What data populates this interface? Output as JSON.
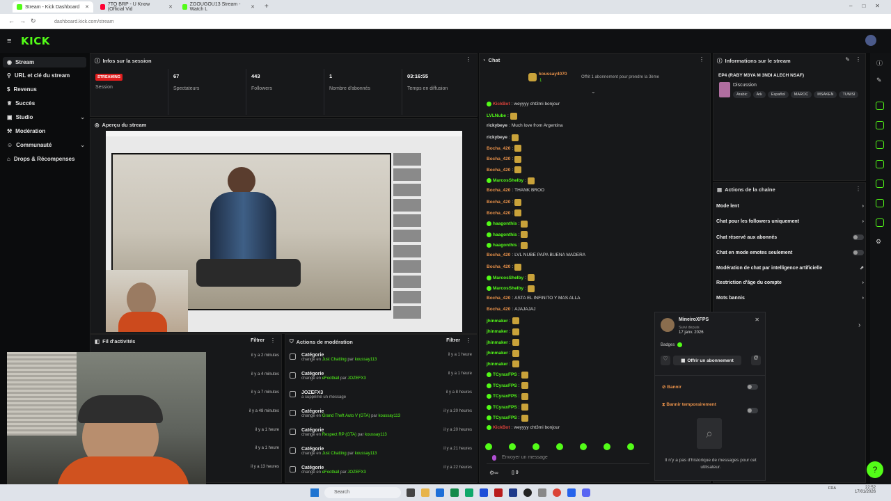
{
  "browser": {
    "tabs": [
      {
        "label": "Stream - Kick Dashboard",
        "color": "#53fc18"
      },
      {
        "label": "7TO BRP - U Know (Official Vid",
        "color": "#ff0033"
      },
      {
        "label": "ZGOUGOU13 Stream - Watch L",
        "color": "#53fc18"
      }
    ],
    "url": "dashboard.kick.com/stream"
  },
  "app": {
    "logo": "KICK"
  },
  "sidebar": {
    "items": [
      {
        "label": "Stream",
        "icon": "stream-icon"
      },
      {
        "label": "URL et clé du stream",
        "icon": "link-icon"
      },
      {
        "label": "Revenus",
        "icon": "dollar-icon"
      },
      {
        "label": "Succès",
        "icon": "trophy-icon"
      },
      {
        "label": "Studio",
        "icon": "studio-icon"
      },
      {
        "label": "Modération",
        "icon": "hammer-icon"
      },
      {
        "label": "Communauté",
        "icon": "users-icon"
      },
      {
        "label": "Drops & Récompenses",
        "icon": "gift-icon"
      }
    ]
  },
  "session": {
    "title": "Infos sur la session",
    "status": "STREAMING",
    "status_label": "Session",
    "stats": [
      {
        "value": "67",
        "label": "Spectateurs"
      },
      {
        "value": "443",
        "label": "Followers"
      },
      {
        "value": "1",
        "label": "Nombre d'abonnés"
      },
      {
        "value": "03:16:55",
        "label": "Temps en diffusion"
      }
    ]
  },
  "preview": {
    "title": "Aperçu du stream"
  },
  "activity": {
    "title": "Fil d'activités",
    "filter": "Filtrer",
    "rows": [
      "il y a 2 minutes",
      "il y a 4 minutes",
      "il y a 7 minutes",
      "il y a 48 minutes",
      "il y a 1 heure",
      "il y a 1 heure",
      "il y a 13 heures"
    ]
  },
  "moderation": {
    "title": "Actions de modération",
    "filter": "Filtrer",
    "rows": [
      {
        "title": "Catégorie",
        "pre": "changé en ",
        "target": "Just Chatting",
        "mid": " par ",
        "user": "koussay113",
        "time": "il y a 1 heure"
      },
      {
        "title": "Catégorie",
        "pre": "changé en ",
        "target": "eFootball",
        "mid": " par ",
        "user": "JOZEFX3",
        "time": "il y a 1 heure"
      },
      {
        "title": "JOZEFX3",
        "pre": "a supprimé un message",
        "target": "",
        "mid": "",
        "user": "",
        "time": "il y a 8 heures"
      },
      {
        "title": "Catégorie",
        "pre": "changé en ",
        "target": "Grand Theft Auto V (GTA)",
        "mid": " par ",
        "user": "koussay113",
        "time": "il y a 20 heures"
      },
      {
        "title": "Catégorie",
        "pre": "changé en ",
        "target": "Respect RP (GTA)",
        "mid": " par ",
        "user": "koussay113",
        "time": "il y a 20 heures"
      },
      {
        "title": "Catégorie",
        "pre": "changé en ",
        "target": "Just Chatting",
        "mid": " par ",
        "user": "koussay113",
        "time": "il y a 21 heures"
      },
      {
        "title": "Catégorie",
        "pre": "changé en ",
        "target": "eFootball",
        "mid": " par ",
        "user": "JOZEFX3",
        "time": "il y a 22 heures"
      }
    ]
  },
  "chat": {
    "title": "Chat",
    "pinned_user": "koussay4070",
    "pinned_count": "1",
    "pinned_text": "Offrit 1 abonnement pour prendre la 3ème",
    "placeholder": "Envoyer un message",
    "counter": "0",
    "messages": [
      {
        "user": "KickBot",
        "color": "#e0443c",
        "text": "weyyyy cht3mi bonjour",
        "verified": true
      },
      {
        "user": "LVLNube",
        "color": "#53fc18",
        "text": "",
        "verified": false,
        "emote": true
      },
      {
        "user": "rickybeye",
        "color": "#ddd",
        "text": "Much love from Argentina",
        "verified": false
      },
      {
        "user": "rickybeye",
        "color": "#ddd",
        "text": "",
        "verified": false,
        "emote": true
      },
      {
        "user": "Bocha_420",
        "color": "#e8914a",
        "text": "",
        "verified": false,
        "emote": true
      },
      {
        "user": "Bocha_420",
        "color": "#e8914a",
        "text": "",
        "verified": false,
        "emote": true
      },
      {
        "user": "Bocha_420",
        "color": "#e8914a",
        "text": "",
        "verified": false,
        "emote": true
      },
      {
        "user": "MarcosShelby",
        "color": "#53fc18",
        "text": "",
        "verified": true,
        "emote": true
      },
      {
        "user": "Bocha_420",
        "color": "#e8914a",
        "text": "THANK BROO",
        "verified": false
      },
      {
        "user": "Bocha_420",
        "color": "#e8914a",
        "text": "",
        "verified": false,
        "emote": true
      },
      {
        "user": "Bocha_420",
        "color": "#e8914a",
        "text": "",
        "verified": false,
        "emote": true
      },
      {
        "user": "haagonthis",
        "color": "#53fc18",
        "text": "",
        "verified": true,
        "emote": true
      },
      {
        "user": "haagonthis",
        "color": "#53fc18",
        "text": "",
        "verified": true,
        "emote": true
      },
      {
        "user": "haagonthis",
        "color": "#53fc18",
        "text": "",
        "verified": true,
        "emote": true
      },
      {
        "user": "Bocha_420",
        "color": "#e8914a",
        "text": "LVL NUBE PAPA BUENA MADERA",
        "verified": false
      },
      {
        "user": "Bocha_420",
        "color": "#e8914a",
        "text": "",
        "verified": false,
        "emote": true
      },
      {
        "user": "MarcosShelby",
        "color": "#53fc18",
        "text": "",
        "verified": true,
        "emote": true
      },
      {
        "user": "MarcosShelby",
        "color": "#53fc18",
        "text": "",
        "verified": true,
        "emote": true
      },
      {
        "user": "Bocha_420",
        "color": "#e8914a",
        "text": "ASTA EL INFINITO Y MAS ALLA",
        "verified": false
      },
      {
        "user": "Bocha_420",
        "color": "#e8914a",
        "text": "AJAJAJAJ",
        "verified": false
      },
      {
        "user": "jhinmaker",
        "color": "#53fc18",
        "text": "",
        "verified": false,
        "emote": true
      },
      {
        "user": "jhinmaker",
        "color": "#53fc18",
        "text": "",
        "verified": false,
        "emote": true
      },
      {
        "user": "jhinmaker",
        "color": "#53fc18",
        "text": "",
        "verified": false,
        "emote": true
      },
      {
        "user": "jhinmaker",
        "color": "#53fc18",
        "text": "",
        "verified": false,
        "emote": true
      },
      {
        "user": "jhinmaker",
        "color": "#53fc18",
        "text": "",
        "verified": false,
        "emote": true
      },
      {
        "user": "TCyraxFPS",
        "color": "#53fc18",
        "text": "",
        "verified": true,
        "emote": true
      },
      {
        "user": "TCyraxFPS",
        "color": "#53fc18",
        "text": "",
        "verified": true,
        "emote": true
      },
      {
        "user": "TCyraxFPS",
        "color": "#53fc18",
        "text": "",
        "verified": true,
        "emote": true
      },
      {
        "user": "TCyraxFPS",
        "color": "#53fc18",
        "text": "",
        "verified": true,
        "emote": true
      },
      {
        "user": "TCyraxFPS",
        "color": "#53fc18",
        "text": "",
        "verified": true,
        "emote": true
      },
      {
        "user": "KickBot",
        "color": "#e0443c",
        "text": "weyyyy cht3mi bonjour",
        "verified": true
      }
    ]
  },
  "stream_info": {
    "title": "Informations sur le stream",
    "stream_title": "EP4 (RABY M3YA M 3NDI ALECH NSAF)",
    "category": "Discussion",
    "tags": [
      "Arabic",
      "Ark",
      "Español",
      "MAROC",
      "MSAKEN",
      "TUNISI"
    ]
  },
  "channel_actions": {
    "title": "Actions de la chaîne",
    "items": [
      {
        "label": "Mode lent",
        "control": "chevron"
      },
      {
        "label": "Chat pour les followers uniquement",
        "control": "chevron"
      },
      {
        "label": "Chat réservé aux abonnés",
        "control": "toggle"
      },
      {
        "label": "Chat en mode emotes seulement",
        "control": "toggle"
      },
      {
        "label": "Modération de chat par intelligence artificielle",
        "control": "external"
      },
      {
        "label": "Restriction d'âge du compte",
        "control": "chevron"
      },
      {
        "label": "Mots bannis",
        "control": "chevron"
      }
    ]
  },
  "user_card": {
    "username": "MineiroXFPS",
    "since_label": "Suivi depuis",
    "since_date": "17 janv. 2026",
    "badges_label": "Badges",
    "gift_label": "Offrir un abonnement",
    "ban_label": "Bannir",
    "timeout_label": "Bannir temporairement",
    "empty_text": "Il n'y a pas d'historique de messages pour cet utilisateur."
  },
  "taskbar": {
    "search": "Search",
    "lang": "FRA",
    "time": "22:52",
    "date": "17/01/2026"
  },
  "colors": {
    "accent": "#53fc18",
    "bg": "#0b0c0d",
    "panel": "#17181a",
    "live": "#e01e1e"
  }
}
